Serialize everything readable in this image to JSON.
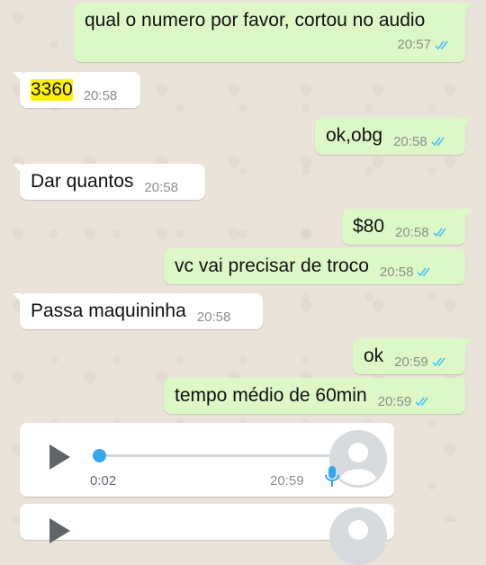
{
  "messages": [
    {
      "text": "qual o numero por favor, cortou no audio",
      "time": "20:57",
      "dir": "out",
      "read": true
    },
    {
      "text": "3360",
      "time": "20:58",
      "dir": "in",
      "highlight": true
    },
    {
      "text": "ok,obg",
      "time": "20:58",
      "dir": "out",
      "read": true
    },
    {
      "text": "Dar quantos",
      "time": "20:58",
      "dir": "in"
    },
    {
      "text": "$80",
      "time": "20:58",
      "dir": "out",
      "read": true
    },
    {
      "text": "vc vai precisar de troco",
      "time": "20:58",
      "dir": "out",
      "read": true
    },
    {
      "text": "Passa maquininha",
      "time": "20:58",
      "dir": "in"
    },
    {
      "text": "ok",
      "time": "20:59",
      "dir": "out",
      "read": true
    },
    {
      "text": "tempo médio de 60min",
      "time": "20:59",
      "dir": "out",
      "read": true
    }
  ],
  "voice_message": {
    "duration": "0:02",
    "time": "20:59",
    "progress": 0,
    "play_icon": "play-icon",
    "mic_icon": "mic-icon",
    "avatar_icon": "default-avatar-icon"
  },
  "colors": {
    "outgoing_bubble": "#dcf8c6",
    "incoming_bubble": "#ffffff",
    "read_ticks": "#4fc3f7",
    "highlight": "#fff200",
    "wallpaper": "#e9e3da"
  }
}
